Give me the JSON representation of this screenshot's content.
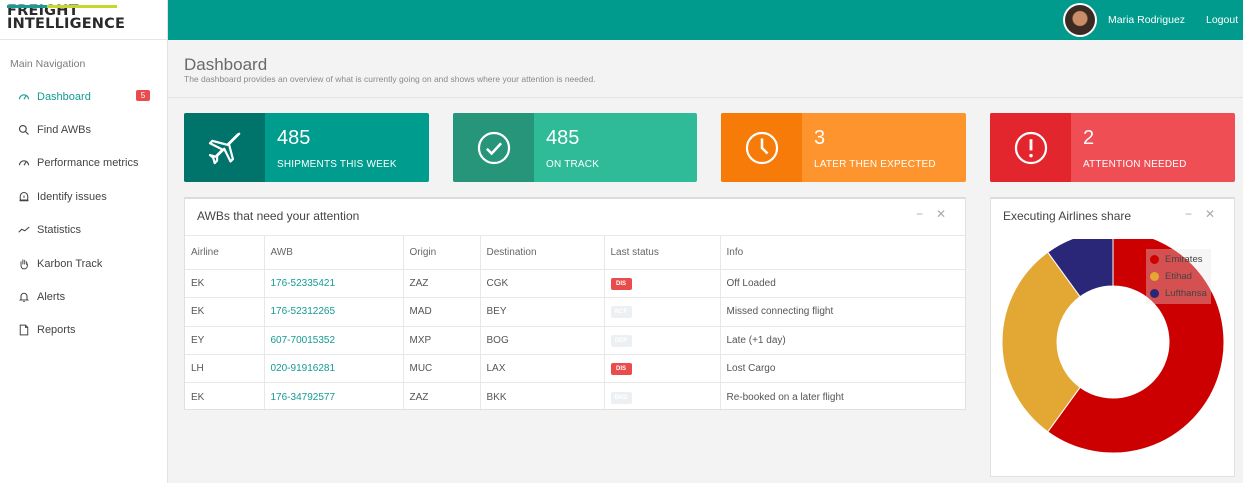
{
  "brand": {
    "line1": "FREIGHT",
    "line2": "INTELLIGENCE"
  },
  "sidebar": {
    "title": "Main Navigation",
    "items": [
      {
        "label": "Dashboard",
        "icon": "gauge-icon",
        "badge": "5"
      },
      {
        "label": "Find AWBs",
        "icon": "search-icon"
      },
      {
        "label": "Performance metrics",
        "icon": "gauge-icon"
      },
      {
        "label": "Identify issues",
        "icon": "alert-icon"
      },
      {
        "label": "Statistics",
        "icon": "trend-icon"
      },
      {
        "label": "Karbon Track",
        "icon": "hand-icon"
      },
      {
        "label": "Alerts",
        "icon": "bell-icon"
      },
      {
        "label": "Reports",
        "icon": "document-icon"
      }
    ]
  },
  "header": {
    "user": "Maria Rodriguez",
    "logout": "Logout"
  },
  "page": {
    "title": "Dashboard",
    "subtitle": "The dashboard provides an overview of what is currently going on and shows where your attention is needed."
  },
  "cards": [
    {
      "value": "485",
      "label": "SHIPMENTS THIS WEEK",
      "icon": "airplane-icon"
    },
    {
      "value": "485",
      "label": "ON TRACK",
      "icon": "check-circle-icon"
    },
    {
      "value": "3",
      "label": "LATER THEN EXPECTED",
      "icon": "clock-icon"
    },
    {
      "value": "2",
      "label": "ATTENTION NEEDED",
      "icon": "exclamation-circle-icon"
    }
  ],
  "awb_panel": {
    "title": "AWBs that need your attention",
    "minimize": "−",
    "close": "✕",
    "columns": [
      "Airline",
      "AWB",
      "Origin",
      "Destination",
      "Last status",
      "Info"
    ],
    "rows": [
      {
        "airline": "EK",
        "awb": "176-52335421",
        "origin": "ZAZ",
        "destination": "CGK",
        "status": "DIS",
        "info": "Off Loaded"
      },
      {
        "airline": "EK",
        "awb": "176-52312265",
        "origin": "MAD",
        "destination": "BEY",
        "status": "RCF",
        "info": "Missed connecting flight"
      },
      {
        "airline": "EY",
        "awb": "607-70015352",
        "origin": "MXP",
        "destination": "BOG",
        "status": "DEP",
        "info": "Late (+1 day)"
      },
      {
        "airline": "LH",
        "awb": "020-91916281",
        "origin": "MUC",
        "destination": "LAX",
        "status": "DIS",
        "info": "Lost Cargo"
      },
      {
        "airline": "EK",
        "awb": "176-34792577",
        "origin": "ZAZ",
        "destination": "BKK",
        "status": "BKD",
        "info": "Re-booked on a later flight"
      }
    ]
  },
  "airline_panel": {
    "title": "Executing Airlines share",
    "minimize": "−",
    "close": "✕"
  },
  "colors": {
    "primary": "#009b8d",
    "emirates": "#cc0000",
    "etihad": "#e3a833",
    "lufthansa": "#2a2778",
    "status_red": "#e84c4c"
  },
  "chart_data": {
    "type": "pie",
    "categories": [
      "Emirates",
      "Etihad",
      "Lufthansa"
    ],
    "values": [
      60,
      30,
      10
    ],
    "title": "Executing Airlines share",
    "legend": "top-right"
  }
}
